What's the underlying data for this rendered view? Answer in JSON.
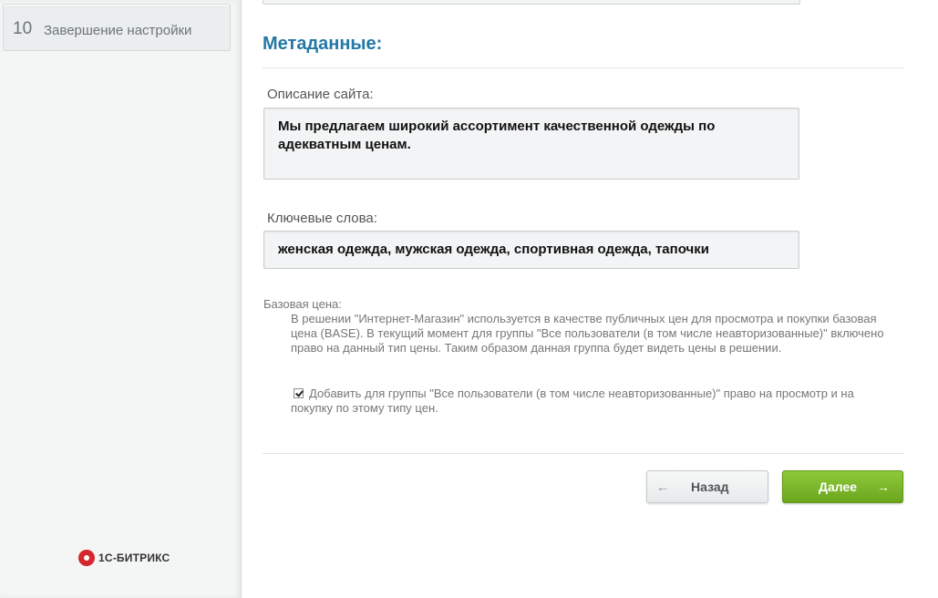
{
  "sidebar": {
    "step": {
      "number": "10",
      "label": "Завершение настройки"
    },
    "logo_text": "1С-БИТРИКС"
  },
  "main": {
    "section_title": "Метаданные:",
    "site_description": {
      "label": "Описание сайта:",
      "value": "Мы предлагаем широкий ассортимент качественной одежды по адекватным ценам."
    },
    "keywords": {
      "label": "Ключевые слова:",
      "value": "женская одежда, мужская одежда, спортивная одежда, тапочки"
    },
    "base_price": {
      "label": "Базовая цена:",
      "description": "В решении \"Интернет-Магазин\" используется в качестве публичных цен для просмотра и покупки базовая цена (BASE). В текущий момент для группы \"Все пользователи (в том числе неавторизованные)\" включено право на данный тип цены. Таким образом данная группа будет видеть цены в решении.",
      "checkbox_label": "Добавить для группы \"Все пользователи (в том числе неавторизованные)\" право на просмотр и на покупку по этому типу цен.",
      "checkbox_checked": true
    },
    "buttons": {
      "back_label": "Назад",
      "next_label": "Далее"
    }
  },
  "colors": {
    "accent": "#2378a6",
    "next_button": "#7ab62a"
  }
}
